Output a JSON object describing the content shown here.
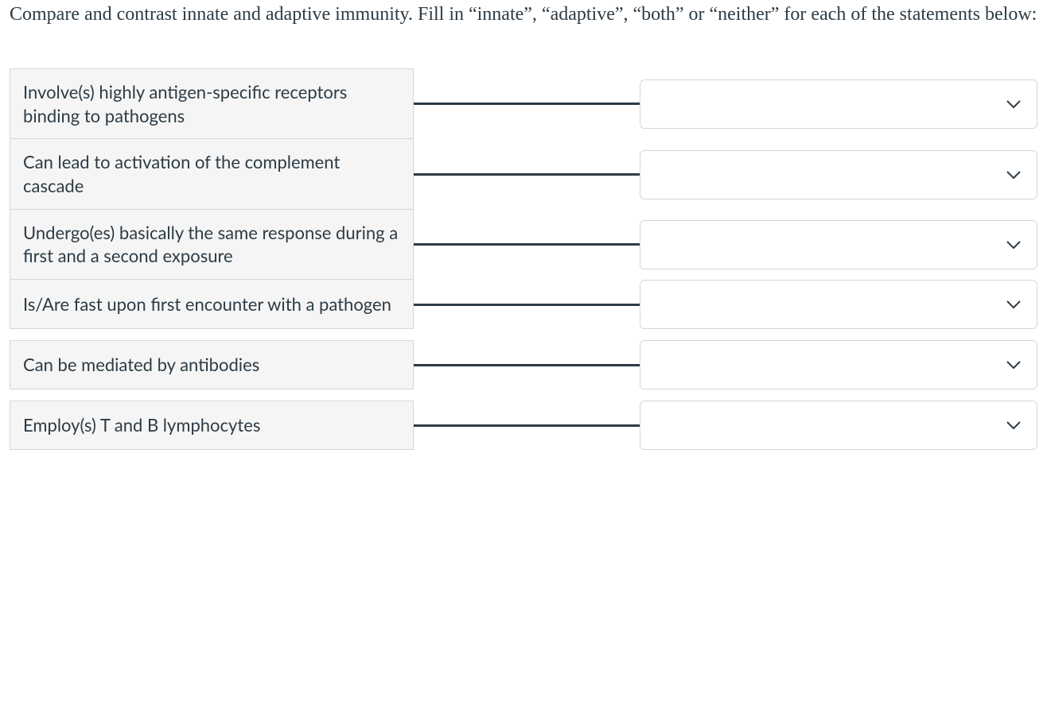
{
  "question": {
    "prompt": "Compare and contrast innate and adaptive immunity. Fill in “innate”, “adaptive”, “both” or “neither” for each of the statements below:"
  },
  "rows": [
    {
      "prompt": "Involve(s) highly antigen-specific receptors binding to pathogens",
      "selected": ""
    },
    {
      "prompt": "Can lead to activation of the complement cascade",
      "selected": ""
    },
    {
      "prompt": "Undergo(es) basically the same response during a first and a second exposure",
      "selected": ""
    },
    {
      "prompt": "Is/Are fast upon first encounter with a pathogen",
      "selected": ""
    },
    {
      "prompt": "Can be mediated by antibodies",
      "selected": ""
    },
    {
      "prompt": "Employ(s) T and B lymphocytes",
      "selected": ""
    }
  ]
}
